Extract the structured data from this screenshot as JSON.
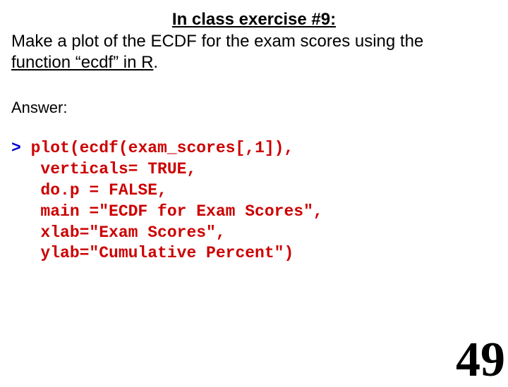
{
  "title": "In class exercise #9:",
  "prompt_line1": "Make a plot of the ECDF for the exam scores using the",
  "prompt_line2_a": "function “ecdf” in R",
  "prompt_line2_b": ".",
  "answer_label": "Answer:",
  "code": {
    "prompt_char": ">",
    "l1": " plot(ecdf(exam_scores[,1]),",
    "l2": "   verticals= TRUE,",
    "l3": "   do.p = FALSE,",
    "l4": "   main =\"ECDF for Exam Scores\",",
    "l5": "   xlab=\"Exam Scores\",",
    "l6": "   ylab=\"Cumulative Percent\")"
  },
  "page_number": "49"
}
